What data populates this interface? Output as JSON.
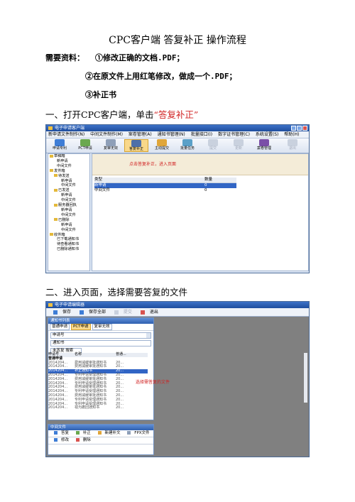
{
  "doc": {
    "title": "CPC客户端 答复补正 操作流程",
    "req_label": "需要资料：",
    "req_items": [
      "①修改正确的文档.PDF；",
      "②在原文件上用红笔修改，做成一个.PDF；",
      "③补正书"
    ],
    "step1_prefix": "一、打开CPC客户端，单击",
    "step1_highlight": "“答复补正”",
    "step2": "二、进入页面，选择需要答复的文件"
  },
  "app1": {
    "title": "电子申请客户端",
    "menu": [
      "新申请文件制作(N)",
      "中间文件制作(M)",
      "案卷管理(A)",
      "通知书管理(N)",
      "批量接口(I)",
      "数字证书管理(C)",
      "系统设置(S)",
      "帮助(H)"
    ],
    "toolbar": [
      "申请专利",
      "PCT申请",
      "复审无效",
      "答复补正",
      "主动提交",
      "批量任务",
      "提交",
      "更新",
      "案卷管理",
      "退出"
    ],
    "tree": [
      "草稿箱",
      "新申请",
      "中间文件",
      "发件箱",
      "待发送",
      "新申请",
      "中间文件",
      "已发送",
      "新申请",
      "中间文件",
      "服务器回执",
      "新申请",
      "中间文件",
      "已删除",
      "新申请",
      "中间文件",
      "收件箱",
      "已下载通知书",
      "待查看通知书",
      "已删除通知书"
    ],
    "note": "点击答复补正，进入页面",
    "table": {
      "headers": [
        "类型",
        "数量"
      ],
      "rows": [
        [
          "新申请",
          "0"
        ],
        [
          "中间文件",
          "0"
        ]
      ]
    }
  },
  "app2": {
    "title": "电子申请编辑器",
    "tools": [
      "保存",
      "保存全部",
      "提交",
      "退出"
    ],
    "list_title": "通知书列表",
    "tabs": [
      "普通申请",
      "PCT申请",
      "复审无效"
    ],
    "field1": "申请号",
    "field2": "通知书",
    "search": "未答复 搜索",
    "headers": [
      "申请号",
      "名称",
      "普通..."
    ],
    "group": "普通申请",
    "rows": [
      [
        "2014204...",
        "费用减缓审批通知书",
        "20..."
      ],
      [
        "2014204...",
        "费用减缓审批通知书",
        "20..."
      ],
      [
        "2014204...",
        "补正通知书",
        "20..."
      ],
      [
        "2014204...",
        "专利申请受理通知书",
        "20..."
      ],
      [
        "2014204...",
        "费用减缓审批通知书",
        "20..."
      ],
      [
        "2014204...",
        "专利申请受理通知书",
        "20..."
      ],
      [
        "2014204...",
        "费用减缓审批通知书",
        "20..."
      ],
      [
        "2014204...",
        "专利申请受理通知书",
        "20..."
      ],
      [
        "2014204...",
        "费用减缓审批通知书",
        "20..."
      ],
      [
        "2014204...",
        "专利申请受理通知书",
        "20..."
      ],
      [
        "2014204...",
        "专利申请受理通知书",
        "20..."
      ],
      [
        "2014204...",
        "视为撤回通知书",
        "20..."
      ]
    ],
    "tip": "选择需答复的文件",
    "bottom_title": "中间文件",
    "bottom_tools": [
      "答复",
      "补正",
      "新建补文",
      "FPX文件"
    ],
    "bottom_tools2": [
      "修改",
      "删除"
    ]
  },
  "colors": {
    "highlight": "#d02020",
    "selection": "#3165c5",
    "titlebar": "#2e5fb0"
  }
}
